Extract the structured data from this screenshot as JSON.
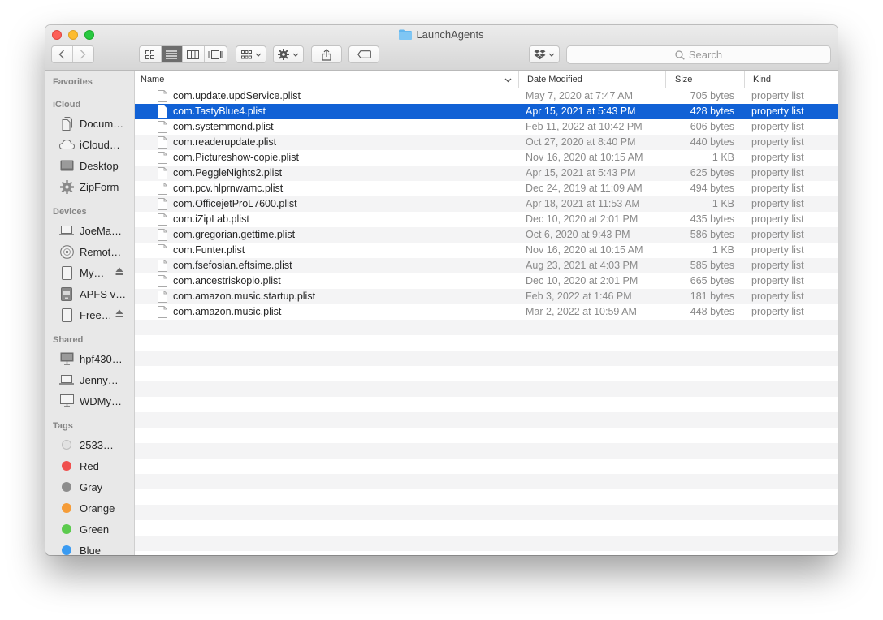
{
  "window": {
    "title": "LaunchAgents"
  },
  "toolbar": {
    "search_placeholder": "Search",
    "view_modes": [
      "icon-view",
      "list-view",
      "column-view",
      "gallery-view"
    ],
    "active_view": "list-view"
  },
  "sidebar": {
    "favorites_label": "Favorites",
    "icloud_label": "iCloud",
    "icloud_items": [
      {
        "label": "Docum…",
        "icon": "documents-icon"
      },
      {
        "label": "iCloud…",
        "icon": "cloud-icon"
      },
      {
        "label": "Desktop",
        "icon": "desktop-icon"
      },
      {
        "label": "ZipForm",
        "icon": "gear-icon"
      }
    ],
    "devices_label": "Devices",
    "devices_items": [
      {
        "label": "JoeMa…",
        "icon": "laptop-icon"
      },
      {
        "label": "Remot…",
        "icon": "disc-icon"
      },
      {
        "label": "My…",
        "icon": "drive-icon",
        "eject": true
      },
      {
        "label": "APFS v…",
        "icon": "external-drive-icon"
      },
      {
        "label": "Free…",
        "icon": "drive-icon",
        "eject": true
      }
    ],
    "shared_label": "Shared",
    "shared_items": [
      {
        "label": "hpf430…",
        "icon": "monitor-icon"
      },
      {
        "label": "Jenny…",
        "icon": "laptop-icon"
      },
      {
        "label": "WDMy…",
        "icon": "monitor-icon"
      }
    ],
    "tags_label": "Tags",
    "tags": [
      {
        "label": "2533…",
        "color": "#e2e2e2"
      },
      {
        "label": "Red",
        "color": "#f0504e"
      },
      {
        "label": "Gray",
        "color": "#8d8d8d"
      },
      {
        "label": "Orange",
        "color": "#f59c38"
      },
      {
        "label": "Green",
        "color": "#5ccb4e"
      },
      {
        "label": "Blue",
        "color": "#3a9bf2"
      }
    ]
  },
  "columns": {
    "name": "Name",
    "date": "Date Modified",
    "size": "Size",
    "kind": "Kind"
  },
  "selected_index": 1,
  "files": [
    {
      "name": "com.update.updService.plist",
      "date": "May 7, 2020 at 7:47 AM",
      "size": "705 bytes",
      "kind": "property list"
    },
    {
      "name": "com.TastyBlue4.plist",
      "date": "Apr 15, 2021 at 5:43 PM",
      "size": "428 bytes",
      "kind": "property list"
    },
    {
      "name": "com.systemmond.plist",
      "date": "Feb 11, 2022 at 10:42 PM",
      "size": "606 bytes",
      "kind": "property list"
    },
    {
      "name": "com.readerupdate.plist",
      "date": "Oct 27, 2020 at 8:40 PM",
      "size": "440 bytes",
      "kind": "property list"
    },
    {
      "name": "com.Pictureshow-copie.plist",
      "date": "Nov 16, 2020 at 10:15 AM",
      "size": "1 KB",
      "kind": "property list"
    },
    {
      "name": "com.PeggleNights2.plist",
      "date": "Apr 15, 2021 at 5:43 PM",
      "size": "625 bytes",
      "kind": "property list"
    },
    {
      "name": "com.pcv.hlprnwamc.plist",
      "date": "Dec 24, 2019 at 11:09 AM",
      "size": "494 bytes",
      "kind": "property list"
    },
    {
      "name": "com.OfficejetProL7600.plist",
      "date": "Apr 18, 2021 at 11:53 AM",
      "size": "1 KB",
      "kind": "property list"
    },
    {
      "name": "com.iZipLab.plist",
      "date": "Dec 10, 2020 at 2:01 PM",
      "size": "435 bytes",
      "kind": "property list"
    },
    {
      "name": "com.gregorian.gettime.plist",
      "date": "Oct 6, 2020 at 9:43 PM",
      "size": "586 bytes",
      "kind": "property list"
    },
    {
      "name": "com.Funter.plist",
      "date": "Nov 16, 2020 at 10:15 AM",
      "size": "1 KB",
      "kind": "property list"
    },
    {
      "name": "com.fsefosian.eftsime.plist",
      "date": "Aug 23, 2021 at 4:03 PM",
      "size": "585 bytes",
      "kind": "property list"
    },
    {
      "name": "com.ancestriskopio.plist",
      "date": "Dec 10, 2020 at 2:01 PM",
      "size": "665 bytes",
      "kind": "property list"
    },
    {
      "name": "com.amazon.music.startup.plist",
      "date": "Feb 3, 2022 at 1:46 PM",
      "size": "181 bytes",
      "kind": "property list"
    },
    {
      "name": "com.amazon.music.plist",
      "date": "Mar 2, 2022 at 10:59 AM",
      "size": "448 bytes",
      "kind": "property list"
    }
  ]
}
